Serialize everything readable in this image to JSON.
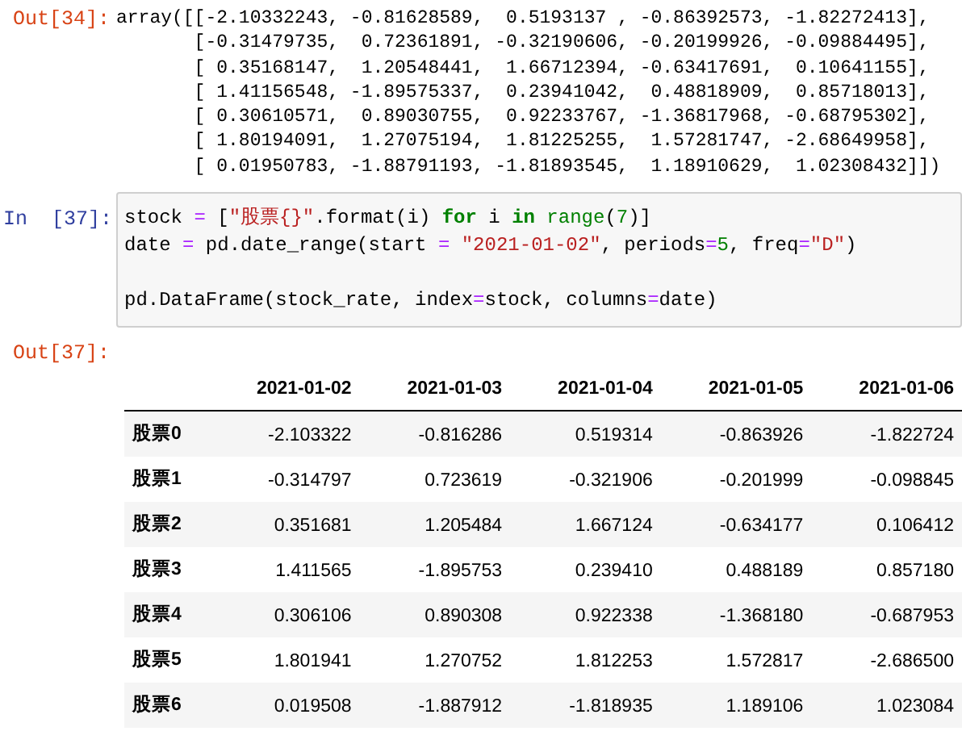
{
  "cells": [
    {
      "kind": "output",
      "prompt": "Out[34]:",
      "text_lines": [
        "array([[-2.10332243, -0.81628589,  0.5193137 , -0.86392573, -1.82272413],",
        "       [-0.31479735,  0.72361891, -0.32190606, -0.20199926, -0.09884495],",
        "       [ 0.35168147,  1.20548441,  1.66712394, -0.63417691,  0.10641155],",
        "       [ 1.41156548, -1.89575337,  0.23941042,  0.48818909,  0.85718013],",
        "       [ 0.30610571,  0.89030755,  0.92233767, -1.36817968, -0.68795302],",
        "       [ 1.80194091,  1.27075194,  1.81225255,  1.57281747, -2.68649958],",
        "       [ 0.01950783, -1.88791193, -1.81893545,  1.18910629,  1.02308432]])"
      ]
    },
    {
      "kind": "input",
      "prompt": "In  [37]:",
      "code_lines": [
        {
          "blank_before": false,
          "tokens": [
            {
              "kind": "plain",
              "text": "stock "
            },
            {
              "kind": "operator",
              "text": "="
            },
            {
              "kind": "plain",
              "text": " ["
            },
            {
              "kind": "string",
              "text": "\"股票{}\""
            },
            {
              "kind": "plain",
              "text": ".format(i) "
            },
            {
              "kind": "keyword",
              "text": "for"
            },
            {
              "kind": "plain",
              "text": " i "
            },
            {
              "kind": "keyword",
              "text": "in"
            },
            {
              "kind": "builtin",
              "text": " range"
            },
            {
              "kind": "plain",
              "text": "("
            },
            {
              "kind": "number",
              "text": "7"
            },
            {
              "kind": "plain",
              "text": ")]"
            }
          ]
        },
        {
          "blank_before": false,
          "tokens": [
            {
              "kind": "plain",
              "text": "date "
            },
            {
              "kind": "operator",
              "text": "="
            },
            {
              "kind": "plain",
              "text": " pd.date_range(start "
            },
            {
              "kind": "operator",
              "text": "="
            },
            {
              "kind": "string",
              "text": " \"2021-01-02\""
            },
            {
              "kind": "plain",
              "text": ", periods"
            },
            {
              "kind": "operator",
              "text": "="
            },
            {
              "kind": "number",
              "text": "5"
            },
            {
              "kind": "plain",
              "text": ", freq"
            },
            {
              "kind": "operator",
              "text": "="
            },
            {
              "kind": "string",
              "text": "\"D\""
            },
            {
              "kind": "plain",
              "text": ")"
            }
          ]
        },
        {
          "blank_before": true,
          "tokens": [
            {
              "kind": "plain",
              "text": "pd.DataFrame(stock_rate, index"
            },
            {
              "kind": "operator",
              "text": "="
            },
            {
              "kind": "plain",
              "text": "stock, columns"
            },
            {
              "kind": "operator",
              "text": "="
            },
            {
              "kind": "plain",
              "text": "date)"
            }
          ]
        }
      ]
    },
    {
      "kind": "table_output",
      "prompt": "Out[37]:",
      "table": {
        "columns": [
          "2021-01-02",
          "2021-01-03",
          "2021-01-04",
          "2021-01-05",
          "2021-01-06"
        ],
        "rows": [
          {
            "index": "股票0",
            "values": [
              "-2.103322",
              "-0.816286",
              "0.519314",
              "-0.863926",
              "-1.822724"
            ]
          },
          {
            "index": "股票1",
            "values": [
              "-0.314797",
              "0.723619",
              "-0.321906",
              "-0.201999",
              "-0.098845"
            ]
          },
          {
            "index": "股票2",
            "values": [
              "0.351681",
              "1.205484",
              "1.667124",
              "-0.634177",
              "0.106412"
            ]
          },
          {
            "index": "股票3",
            "values": [
              "1.411565",
              "-1.895753",
              "0.239410",
              "0.488189",
              "0.857180"
            ]
          },
          {
            "index": "股票4",
            "values": [
              "0.306106",
              "0.890308",
              "0.922338",
              "-1.368180",
              "-0.687953"
            ]
          },
          {
            "index": "股票5",
            "values": [
              "1.801941",
              "1.270752",
              "1.812253",
              "1.572817",
              "-2.686500"
            ]
          },
          {
            "index": "股票6",
            "values": [
              "0.019508",
              "-1.887912",
              "-1.818935",
              "1.189106",
              "1.023084"
            ]
          }
        ]
      }
    }
  ]
}
